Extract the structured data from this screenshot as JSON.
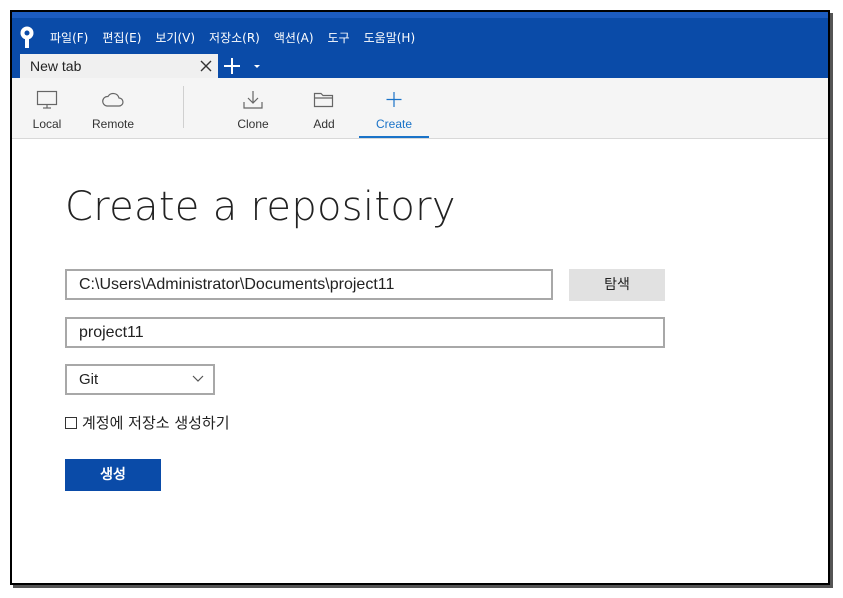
{
  "menu": {
    "items": [
      "파일(F)",
      "편집(E)",
      "보기(V)",
      "저장소(R)",
      "액션(A)",
      "도구",
      "도움말(H)"
    ]
  },
  "tabs": [
    {
      "title": "New tab"
    }
  ],
  "toolbar": {
    "local": "Local",
    "remote": "Remote",
    "clone": "Clone",
    "add": "Add",
    "create": "Create"
  },
  "main": {
    "title": "Create a repository",
    "path_value": "C:\\Users\\Administrator\\Documents\\project11",
    "browse_label": "탐색",
    "name_value": "project11",
    "repo_type": "Git",
    "checkbox_label": "계정에 저장소 생성하기",
    "checkbox_checked": false,
    "create_label": "생성"
  },
  "colors": {
    "accent": "#0a4ba8",
    "active_tab": "#1a73c8"
  },
  "icons": [
    "sourcetree-logo-icon",
    "close-icon",
    "plus-icon",
    "chevron-down-icon",
    "monitor-icon",
    "cloud-icon",
    "download-icon",
    "folder-icon",
    "plus-icon",
    "chevron-down-icon"
  ]
}
